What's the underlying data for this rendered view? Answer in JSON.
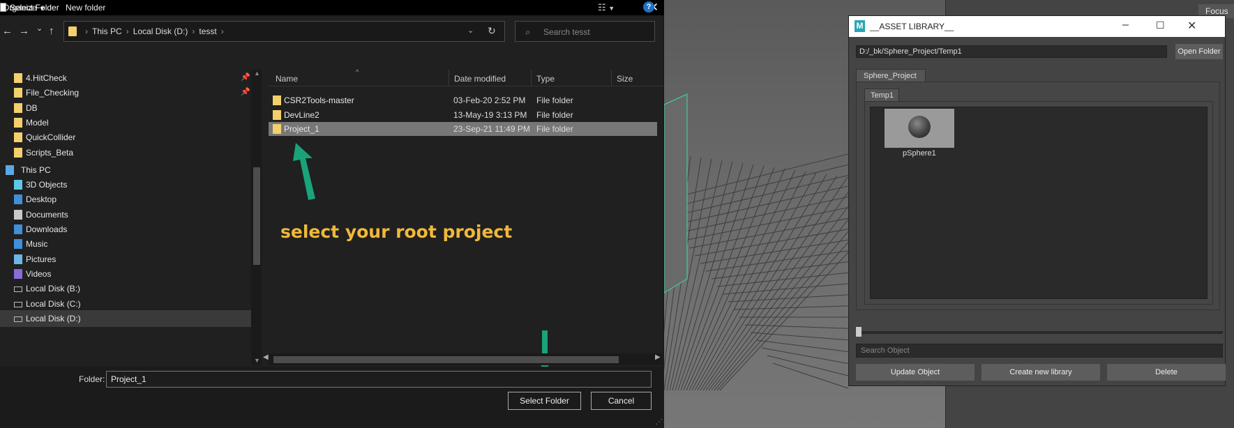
{
  "background": {
    "focus_tab": "Focus"
  },
  "dialog": {
    "title": "Select Folder",
    "close_glyph": "✕",
    "nav": {
      "back": "←",
      "forward": "→",
      "history": "⌄",
      "up": "↑"
    },
    "address": [
      "This PC",
      "Local Disk (D:)",
      "tesst"
    ],
    "address_sep": "›",
    "search_placeholder": "Search tesst",
    "toolbar": {
      "organize": "Organize",
      "new_folder": "New folder"
    },
    "nav_pane": [
      {
        "label": "4.HitCheck",
        "icon": "folder-icon",
        "pinned": true,
        "indent": 1
      },
      {
        "label": "File_Checking",
        "icon": "folder-icon",
        "pinned": true,
        "indent": 1
      },
      {
        "label": "DB",
        "icon": "folder-icon",
        "pinned": false,
        "indent": 1
      },
      {
        "label": "Model",
        "icon": "folder-icon",
        "pinned": false,
        "indent": 1
      },
      {
        "label": "QuickCollider",
        "icon": "folder-icon",
        "pinned": false,
        "indent": 1
      },
      {
        "label": "Scripts_Beta",
        "icon": "folder-icon",
        "pinned": false,
        "indent": 1
      },
      {
        "label": "This PC",
        "icon": "pc-icon",
        "pinned": false,
        "indent": 0
      },
      {
        "label": "3D Objects",
        "icon": "3d-objects-icon",
        "pinned": false,
        "indent": 1
      },
      {
        "label": "Desktop",
        "icon": "desktop-icon",
        "pinned": false,
        "indent": 1
      },
      {
        "label": "Documents",
        "icon": "documents-icon",
        "pinned": false,
        "indent": 1
      },
      {
        "label": "Downloads",
        "icon": "downloads-icon",
        "pinned": false,
        "indent": 1
      },
      {
        "label": "Music",
        "icon": "music-icon",
        "pinned": false,
        "indent": 1
      },
      {
        "label": "Pictures",
        "icon": "pictures-icon",
        "pinned": false,
        "indent": 1
      },
      {
        "label": "Videos",
        "icon": "videos-icon",
        "pinned": false,
        "indent": 1
      },
      {
        "label": "Local Disk (B:)",
        "icon": "drive-icon",
        "pinned": false,
        "indent": 1
      },
      {
        "label": "Local Disk (C:)",
        "icon": "drive-icon",
        "pinned": false,
        "indent": 1
      },
      {
        "label": "Local Disk (D:)",
        "icon": "drive-icon",
        "pinned": false,
        "indent": 1,
        "selected": true
      }
    ],
    "columns": {
      "name": "Name",
      "date": "Date modified",
      "type": "Type",
      "size": "Size"
    },
    "files": [
      {
        "name": "CSR2Tools-master",
        "date": "03-Feb-20 2:52 PM",
        "type": "File folder",
        "selected": false
      },
      {
        "name": "DevLine2",
        "date": "13-May-19 3:13 PM",
        "type": "File folder",
        "selected": false
      },
      {
        "name": "Project_1",
        "date": "23-Sep-21 11:49 PM",
        "type": "File folder",
        "selected": true
      }
    ],
    "annotation": "select your root project",
    "folder_label": "Folder:",
    "folder_value": "Project_1",
    "select_button": "Select Folder",
    "cancel_button": "Cancel",
    "arrow_color": "#1aa37a",
    "annotation_color": "#f0b83a"
  },
  "asset_library": {
    "title": "__ASSET LIBRARY__",
    "logo": "M",
    "path": "D:/_bk/Sphere_Project/Temp1",
    "open_folder": "Open Folder",
    "project_tab": "Sphere_Project",
    "sub_tab": "Temp1",
    "asset_name": "pSphere1",
    "search_placeholder": "Search Object",
    "update_button": "Update Object",
    "create_button": "Create new library",
    "delete_button": "Delete"
  }
}
